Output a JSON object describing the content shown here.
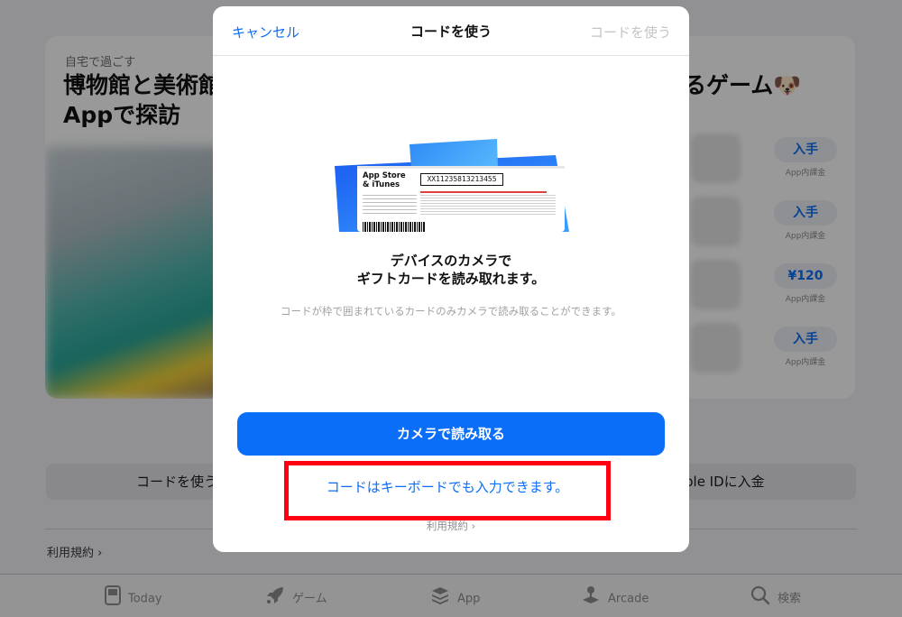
{
  "background": {
    "card": {
      "subtitle": "自宅で過ごす",
      "title_left": "博物館と美術館\nAppで探訪",
      "title_right": "るゲーム🐶",
      "apps": [
        {
          "button": "入手",
          "note": "App内課金"
        },
        {
          "button": "入手",
          "note": "App内課金"
        },
        {
          "button": "¥120",
          "note": "App内課金"
        },
        {
          "button": "入手",
          "note": "App内課金"
        }
      ]
    },
    "buttons": {
      "redeem_code": "コードを使う",
      "add_funds": "ple IDに入金"
    },
    "terms": "利用規約 ›"
  },
  "tabbar": {
    "tabs": [
      {
        "label": "Today",
        "icon": "today-icon"
      },
      {
        "label": "ゲーム",
        "icon": "rocket-icon"
      },
      {
        "label": "App",
        "icon": "app-stack-icon"
      },
      {
        "label": "Arcade",
        "icon": "joystick-icon"
      },
      {
        "label": "検索",
        "icon": "search-icon"
      }
    ]
  },
  "sheet": {
    "header": {
      "cancel": "キャンセル",
      "title": "コードを使う",
      "redeem": "コードを使う"
    },
    "gift_card": {
      "brand_line1": "App Store",
      "brand_line2": "& iTunes",
      "code": "XX11235813213455"
    },
    "message_line1": "デバイスのカメラで",
    "message_line2": "ギフトカードを読み取れます。",
    "hint": "コードが枠で囲まれているカードのみカメラで読み取ることができます。",
    "camera_button": "カメラで読み取る",
    "keyboard_link": "コードはキーボードでも入力できます。",
    "terms": "利用規約 ›"
  },
  "colors": {
    "accent": "#0a6ef9",
    "highlight": "#ff0012"
  }
}
